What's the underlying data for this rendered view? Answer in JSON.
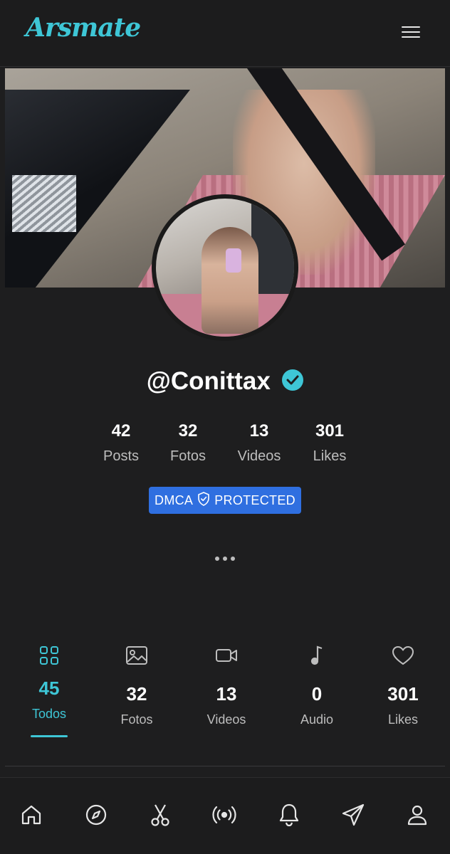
{
  "app": {
    "logo_text": "Arsmate"
  },
  "header": {
    "menu_icon": "hamburger-menu-icon"
  },
  "profile": {
    "username": "@Conittax",
    "verified": true,
    "accent_color": "#3ec6d6"
  },
  "stats": [
    {
      "value": "42",
      "label": "Posts"
    },
    {
      "value": "32",
      "label": "Fotos"
    },
    {
      "value": "13",
      "label": "Videos"
    },
    {
      "value": "301",
      "label": "Likes"
    }
  ],
  "dmca": {
    "left_text": "DMCA",
    "right_text": "PROTECTED",
    "color": "#2f6fe0",
    "icon": "shield-check-icon"
  },
  "more_icon": "more-dots-icon",
  "media_tabs": [
    {
      "value": "45",
      "label": "Todos",
      "icon": "grid-icon",
      "active": true
    },
    {
      "value": "32",
      "label": "Fotos",
      "icon": "image-icon",
      "active": false
    },
    {
      "value": "13",
      "label": "Videos",
      "icon": "video-camera-icon",
      "active": false
    },
    {
      "value": "0",
      "label": "Audio",
      "icon": "music-note-icon",
      "active": false
    },
    {
      "value": "301",
      "label": "Likes",
      "icon": "heart-icon",
      "active": false
    }
  ],
  "bottom_nav": [
    {
      "icon": "home-icon"
    },
    {
      "icon": "compass-icon"
    },
    {
      "icon": "scissors-icon"
    },
    {
      "icon": "live-broadcast-icon"
    },
    {
      "icon": "bell-icon"
    },
    {
      "icon": "send-icon"
    },
    {
      "icon": "user-icon"
    }
  ]
}
